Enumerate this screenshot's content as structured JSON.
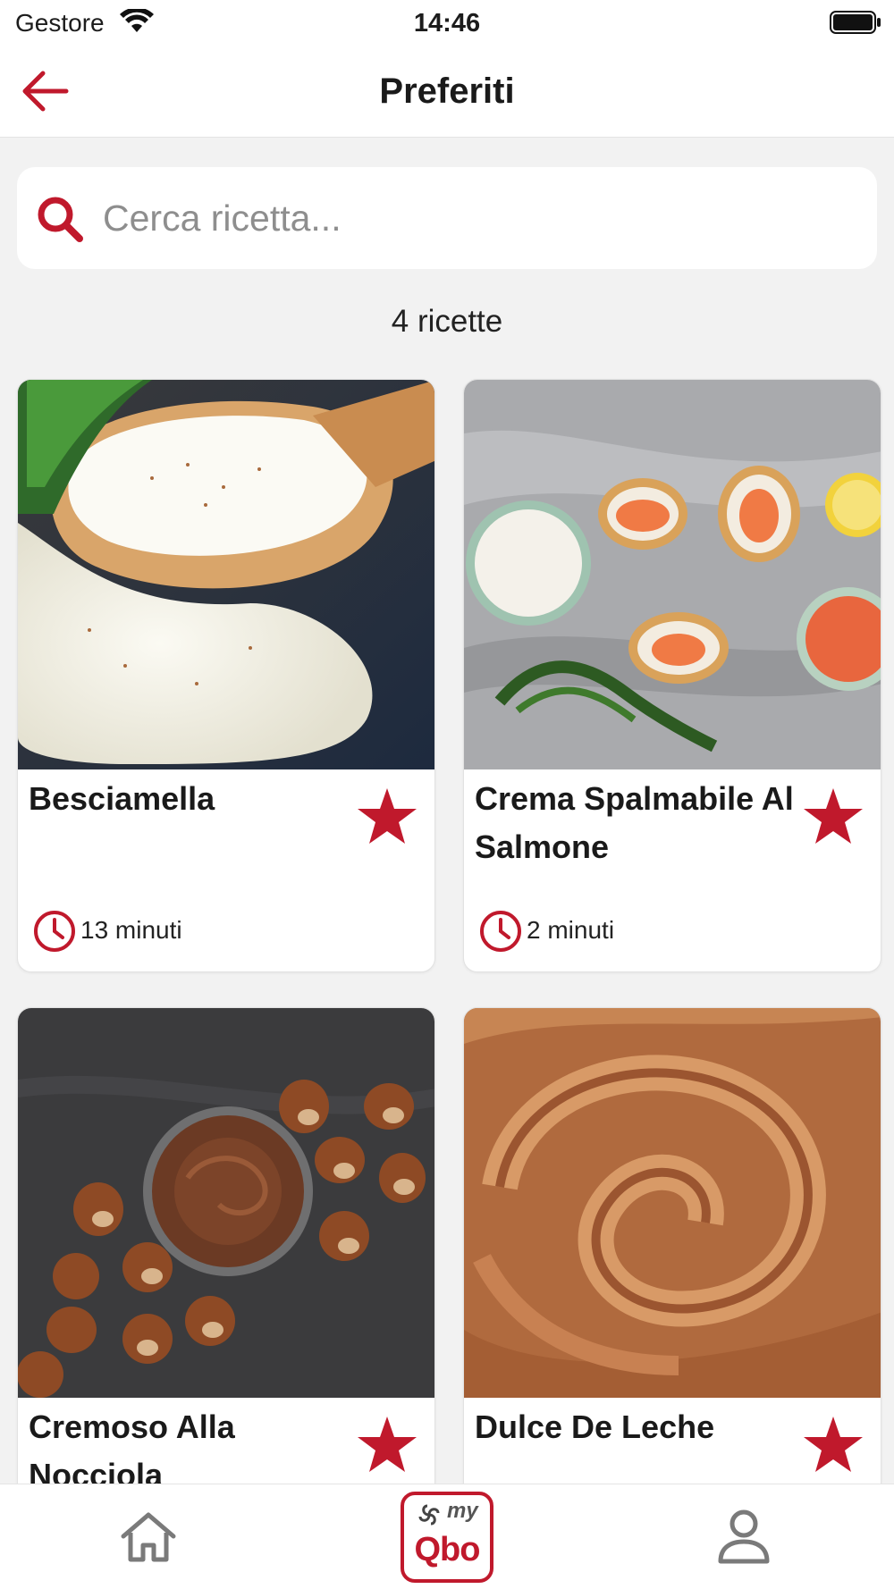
{
  "status_bar": {
    "carrier": "Gestore",
    "time": "14:46"
  },
  "header": {
    "title": "Preferiti",
    "back_icon": "arrow-left-icon"
  },
  "search": {
    "placeholder": "Cerca ricetta...",
    "value": ""
  },
  "recipe_count": "4 ricette",
  "recipes": [
    {
      "title": "Besciamella",
      "time": "13 minuti",
      "favorite": true
    },
    {
      "title": "Crema Spalmabile Al Salmone",
      "time": "2 minuti",
      "favorite": true
    },
    {
      "title": "Cremoso Alla Nocciola",
      "time": "",
      "favorite": true
    },
    {
      "title": "Dulce De Leche",
      "time": "",
      "favorite": true
    }
  ],
  "tab_bar": {
    "items": [
      {
        "name": "home",
        "icon": "home-icon"
      },
      {
        "name": "myqbo",
        "my": "my",
        "label": "Qbo"
      },
      {
        "name": "profile",
        "icon": "user-icon"
      }
    ]
  },
  "colors": {
    "accent": "#c0192c",
    "background": "#f2f2f2",
    "card": "#ffffff"
  }
}
